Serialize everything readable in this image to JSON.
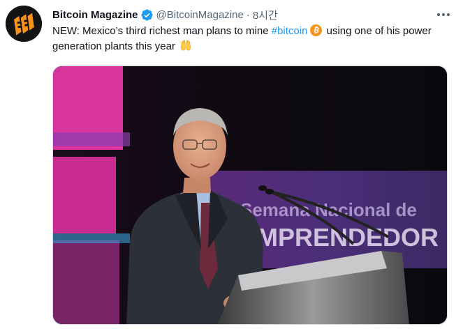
{
  "tweet": {
    "author": {
      "display_name": "Bitcoin Magazine",
      "handle": "@BitcoinMagazine",
      "verified": true
    },
    "separator": "·",
    "time": "8시간",
    "text": {
      "part1": "NEW: Mexico’s third richest man plans to mine ",
      "hashtag": "#bitcoin",
      "part2": "  using one of his power generation plants this year "
    },
    "emojis": [
      "bitcoin-emoji",
      "raising-hands-emoji"
    ],
    "media": {
      "banner_line1": "Semana Nacional de",
      "banner_line2": "EMPRENDEDOR"
    }
  },
  "colors": {
    "link": "#1d9bf0",
    "secondary_text": "#536471",
    "verified_badge": "#1d9bf0",
    "logo_orange": "#f7931a"
  }
}
